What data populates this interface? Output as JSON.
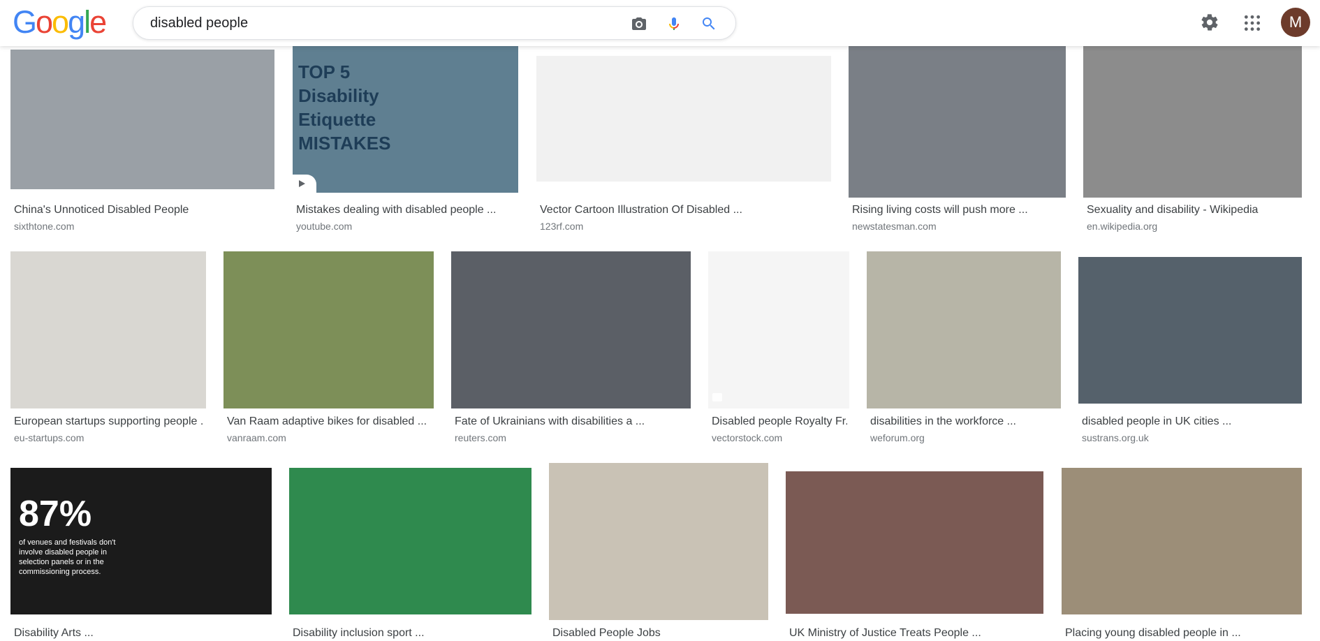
{
  "header": {
    "logo_letters": [
      "G",
      "o",
      "o",
      "g",
      "l",
      "e"
    ],
    "logo_colors": [
      "#4285F4",
      "#EA4335",
      "#FBBC05",
      "#4285F4",
      "#34A853",
      "#EA4335"
    ],
    "search_query": "disabled people",
    "avatar_initial": "M",
    "icons": {
      "camera": "camera-icon",
      "mic": "mic-icon",
      "search": "search-icon",
      "settings": "gear-icon",
      "apps": "apps-grid-icon"
    }
  },
  "thumb_overlays": {
    "youtube": "TOP 5\nDisability Etiquette\nMISTAKES",
    "arts_big": "87%",
    "arts_small": "of venues and festivals don't involve disabled people in selection panels or in the commissioning process."
  },
  "results": [
    {
      "title": "China's Unnoticed Disabled People",
      "source": "sixthtone.com",
      "color": "#9aa0a6"
    },
    {
      "title": "Mistakes dealing with disabled people ...",
      "source": "youtube.com",
      "color": "#5f7f91"
    },
    {
      "title": "Vector Cartoon Illustration Of Disabled ...",
      "source": "123rf.com",
      "color": "#f1f1f1"
    },
    {
      "title": "Rising living costs will push more ...",
      "source": "newstatesman.com",
      "color": "#7a7f86"
    },
    {
      "title": "Sexuality and disability - Wikipedia",
      "source": "en.wikipedia.org",
      "color": "#8c8c8c"
    },
    {
      "title": "European startups supporting people ...",
      "source": "eu-startups.com",
      "color": "#d9d7d2"
    },
    {
      "title": "Van Raam adaptive bikes for disabled ...",
      "source": "vanraam.com",
      "color": "#7d8f58"
    },
    {
      "title": "Fate of Ukrainians with disabilities a ...",
      "source": "reuters.com",
      "color": "#5b5f66"
    },
    {
      "title": "Disabled people Royalty Fr...",
      "source": "vectorstock.com",
      "color": "#f5f5f5"
    },
    {
      "title": "disabilities in the workforce ...",
      "source": "weforum.org",
      "color": "#b7b5a7"
    },
    {
      "title": "disabled people in UK cities ...",
      "source": "sustrans.org.uk",
      "color": "#55616b"
    },
    {
      "title": "Disability Arts ...",
      "source": "",
      "color": "#1b1b1b"
    },
    {
      "title": "Disability inclusion sport ...",
      "source": "",
      "color": "#2f8a4e"
    },
    {
      "title": "Disabled People Jobs",
      "source": "",
      "color": "#c9c2b5"
    },
    {
      "title": "UK Ministry of Justice Treats People ...",
      "source": "",
      "color": "#7b5a54"
    },
    {
      "title": "Placing young disabled people in ...",
      "source": "",
      "color": "#9c8e78"
    }
  ]
}
